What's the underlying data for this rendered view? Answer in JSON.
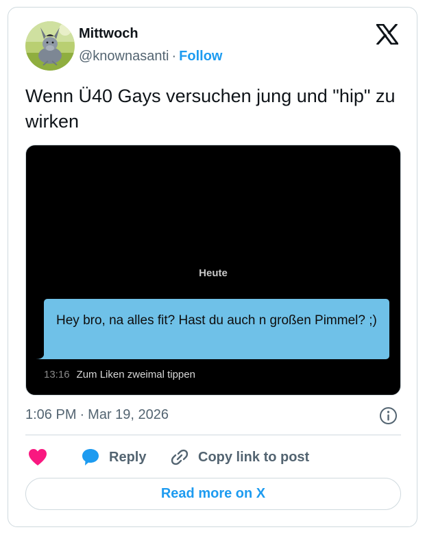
{
  "author": {
    "display_name": "Mittwoch",
    "handle": "@knownasanti",
    "separator": "·",
    "follow_label": "Follow"
  },
  "tweet": {
    "text": "Wenn Ü40 Gays versuchen jung und \"hip\" zu wirken"
  },
  "media": {
    "date_separator": "Heute",
    "message_text": "Hey bro, na alles fit? Hast du auch n großen Pimmel? ;)",
    "message_time": "13:16",
    "message_hint": "Zum Liken zweimal tippen"
  },
  "meta": {
    "time": "1:06 PM",
    "separator": "·",
    "date": "Mar 19, 2026"
  },
  "actions": {
    "reply_label": "Reply",
    "copy_link_label": "Copy link to post",
    "read_more_label": "Read more on X"
  },
  "colors": {
    "accent": "#1d9bf0",
    "like": "#f91880",
    "bubble": "#6fc1e8",
    "muted": "#536471"
  },
  "icons": [
    "x-logo-icon",
    "info-icon",
    "heart-icon",
    "speech-bubble-icon",
    "link-icon"
  ]
}
